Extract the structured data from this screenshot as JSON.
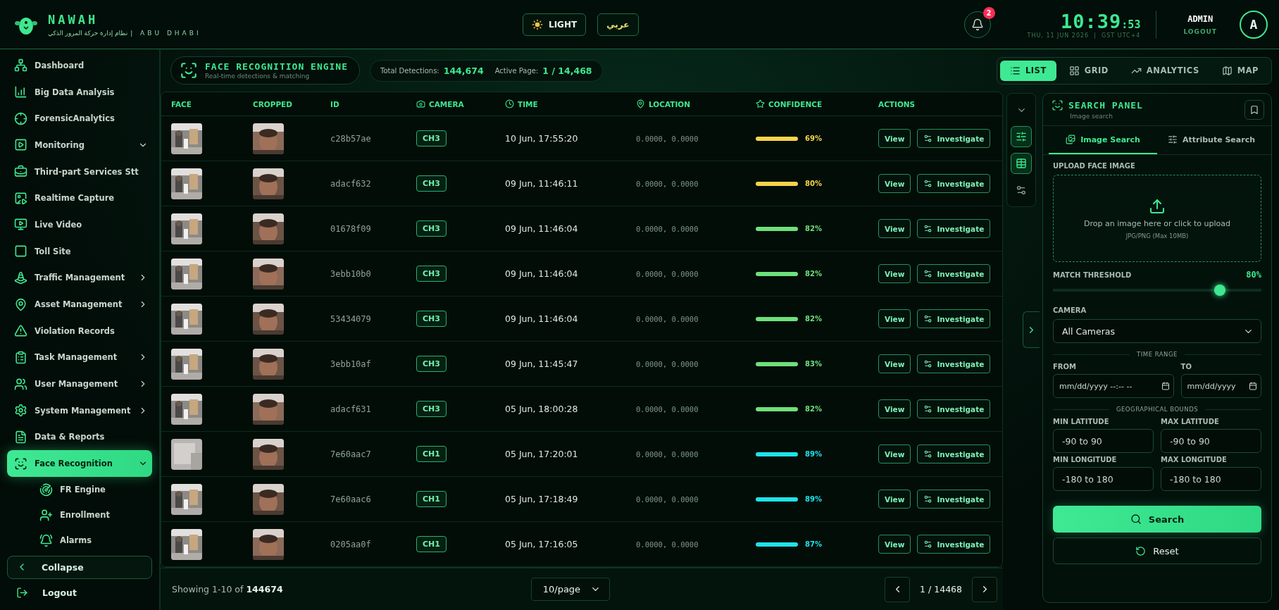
{
  "header": {
    "brand": "NAWAH",
    "tagline_ar": "نظام إدارة حركة المرور الذكي",
    "tagline_en": "| ABU DHABI",
    "theme_button": "LIGHT",
    "language_button": "عربي",
    "notifications": {
      "count": "2"
    },
    "clock": {
      "time": "10:39",
      "seconds": ":53",
      "date": "THU, 11 JUN 2026  |  GST UTC+4"
    },
    "user": {
      "name": "ADMIN",
      "logout": "LOGOUT",
      "avatar": "A"
    }
  },
  "sidebar": {
    "items": [
      {
        "label": "Dashboard",
        "selected": false
      },
      {
        "label": "Big Data Analysis",
        "selected": false
      },
      {
        "label": "ForensicAnalytics",
        "selected": false
      },
      {
        "label": "Monitoring",
        "selected": false,
        "expanded": true
      },
      {
        "label": "Third-part Services Stt",
        "selected": false
      },
      {
        "label": "Realtime Capture",
        "selected": false
      },
      {
        "label": "Live Video",
        "selected": false
      },
      {
        "label": "Toll Site",
        "selected": false
      },
      {
        "label": "Traffic Management",
        "selected": false,
        "expanded": false
      },
      {
        "label": "Asset Management",
        "selected": false,
        "expanded": false
      },
      {
        "label": "Violation Records",
        "selected": false
      },
      {
        "label": "Task Management",
        "selected": false,
        "expanded": false
      },
      {
        "label": "User Management",
        "selected": false,
        "expanded": false
      },
      {
        "label": "System Management",
        "selected": false,
        "expanded": false
      },
      {
        "label": "Data & Reports",
        "selected": false
      },
      {
        "label": "Face Recognition",
        "selected": true,
        "expanded": true,
        "children": [
          {
            "label": "FR Engine",
            "selected": false
          },
          {
            "label": "Enrollment",
            "selected": false
          },
          {
            "label": "Alarms",
            "selected": false
          }
        ]
      }
    ],
    "collapse": "Collapse",
    "logout": "Logout"
  },
  "toolbar": {
    "title": "FACE RECOGNITION ENGINE",
    "subtitle": "Real-time detections & matching",
    "stats": [
      {
        "label": "Total Detections:",
        "value": "144,674"
      },
      {
        "label": "Active Page:",
        "value": "1 / 14,468"
      }
    ],
    "views": [
      {
        "label": "LIST",
        "selected": true
      },
      {
        "label": "GRID",
        "selected": false
      },
      {
        "label": "ANALYTICS",
        "selected": false
      },
      {
        "label": "MAP",
        "selected": false
      }
    ]
  },
  "table": {
    "columns": [
      "FACE",
      "CROPPED",
      "ID",
      "CAMERA",
      "TIME",
      "LOCATION",
      "CONFIDENCE",
      "ACTIONS"
    ],
    "rows": [
      {
        "id": "c28b57ae",
        "camera": "CH3",
        "time": "10 Jun, 17:55:20",
        "location": "0.0000, 0.0000",
        "confidence": "69%",
        "color": "#f5d44a",
        "view": "View",
        "investigate": "Investigate"
      },
      {
        "id": "adacf632",
        "camera": "CH3",
        "time": "09 Jun, 11:46:11",
        "location": "0.0000, 0.0000",
        "confidence": "80%",
        "color": "#f5d44a",
        "view": "View",
        "investigate": "Investigate"
      },
      {
        "id": "01678f09",
        "camera": "CH3",
        "time": "09 Jun, 11:46:04",
        "location": "0.0000, 0.0000",
        "confidence": "82%",
        "color": "#6ee07a",
        "view": "View",
        "investigate": "Investigate"
      },
      {
        "id": "3ebb10b0",
        "camera": "CH3",
        "time": "09 Jun, 11:46:04",
        "location": "0.0000, 0.0000",
        "confidence": "82%",
        "color": "#6ee07a",
        "view": "View",
        "investigate": "Investigate"
      },
      {
        "id": "53434079",
        "camera": "CH3",
        "time": "09 Jun, 11:46:04",
        "location": "0.0000, 0.0000",
        "confidence": "82%",
        "color": "#6ee07a",
        "view": "View",
        "investigate": "Investigate"
      },
      {
        "id": "3ebb10af",
        "camera": "CH3",
        "time": "09 Jun, 11:45:47",
        "location": "0.0000, 0.0000",
        "confidence": "83%",
        "color": "#6ee07a",
        "view": "View",
        "investigate": "Investigate"
      },
      {
        "id": "adacf631",
        "camera": "CH3",
        "time": "05 Jun, 18:00:28",
        "location": "0.0000, 0.0000",
        "confidence": "82%",
        "color": "#6ee07a",
        "view": "View",
        "investigate": "Investigate"
      },
      {
        "id": "7e60aac7",
        "camera": "CH1",
        "time": "05 Jun, 17:20:01",
        "location": "0.0000, 0.0000",
        "confidence": "89%",
        "color": "#1ee3e8",
        "view": "View",
        "investigate": "Investigate"
      },
      {
        "id": "7e60aac6",
        "camera": "CH1",
        "time": "05 Jun, 17:18:49",
        "location": "0.0000, 0.0000",
        "confidence": "89%",
        "color": "#1ee3e8",
        "view": "View",
        "investigate": "Investigate"
      },
      {
        "id": "0205aa0f",
        "camera": "CH1",
        "time": "05 Jun, 17:16:05",
        "location": "0.0000, 0.0000",
        "confidence": "87%",
        "color": "#1ee3e8",
        "view": "View",
        "investigate": "Investigate"
      }
    ]
  },
  "tool_buttons": [
    {
      "selected": true
    },
    {
      "selected": true
    },
    {
      "selected": false
    }
  ],
  "footer": {
    "summary": "Showing 1-10 of **144674**",
    "page_size": "10/page",
    "page": "1 / 14468"
  },
  "search_panel": {
    "title": "SEARCH PANEL",
    "subtitle": "Image search",
    "tabs": [
      {
        "label": "Image Search",
        "selected": true
      },
      {
        "label": "Attribute Search",
        "selected": false
      }
    ],
    "upload": {
      "label": "UPLOAD FACE IMAGE",
      "prompt": "Drop an image here or click to upload",
      "hint": "JPG/PNG (Max 10MB)"
    },
    "threshold": {
      "label": "MATCH THRESHOLD",
      "reading": "80%",
      "level": 0.8
    },
    "camera": {
      "label": "CAMERA",
      "value": "All Cameras"
    },
    "time_range": {
      "heading": "TIME RANGE",
      "fields": [
        {
          "label": "FROM",
          "placeholder": "mm/dd/yyyy --:-- --"
        },
        {
          "label": "TO",
          "placeholder": "mm/dd/yyyy"
        }
      ]
    },
    "geo": {
      "heading": "GEOGRAPHICAL BOUNDS",
      "fields": [
        {
          "label": "MIN LATITUDE",
          "placeholder": "-90 to 90"
        },
        {
          "label": "MAX LATITUDE",
          "placeholder": "-90 to 90"
        },
        {
          "label": "MIN LONGITUDE",
          "placeholder": "-180 to 180"
        },
        {
          "label": "MAX LONGITUDE",
          "placeholder": "-180 to 180"
        }
      ]
    },
    "search_button": "Search",
    "reset_button": "Reset"
  }
}
